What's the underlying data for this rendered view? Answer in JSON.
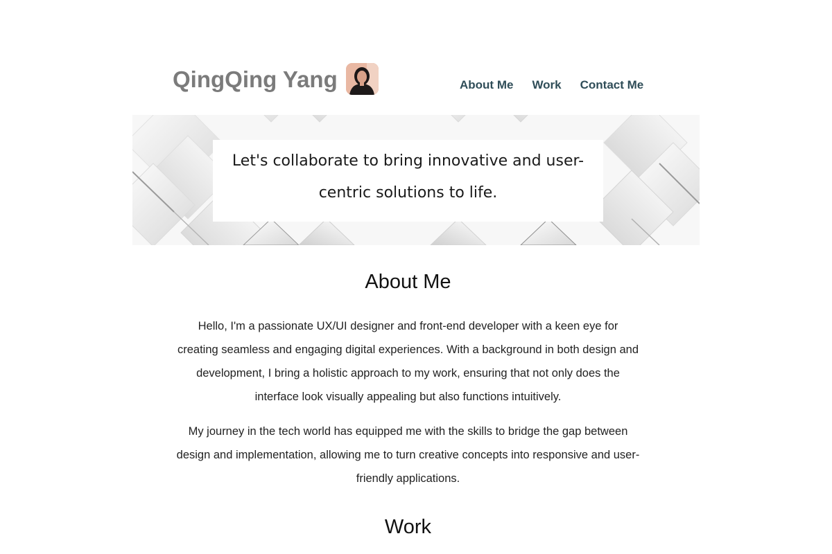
{
  "header": {
    "site_name": "QingQing Yang",
    "nav": [
      "About Me",
      "Work",
      "Contact Me"
    ]
  },
  "hero": {
    "tagline": "Let's collaborate to bring innovative and user-centric solutions to life."
  },
  "about": {
    "title": "About Me",
    "paragraphs": [
      "Hello, I'm a passionate UX/UI designer and front-end developer with a keen eye for creating seamless and engaging digital experiences. With a background in both design and development, I bring a holistic approach to my work, ensuring that not only does the interface look visually appealing but also functions intuitively.",
      "My journey in the tech world has equipped me with the skills to bridge the gap between design and implementation, allowing me to turn creative concepts into responsive and user-friendly applications."
    ]
  },
  "work": {
    "title": "Work"
  },
  "colors": {
    "site_name": "#7b7b7b",
    "nav_link": "#2f4d58",
    "hero_background": "#f4f4f4"
  }
}
